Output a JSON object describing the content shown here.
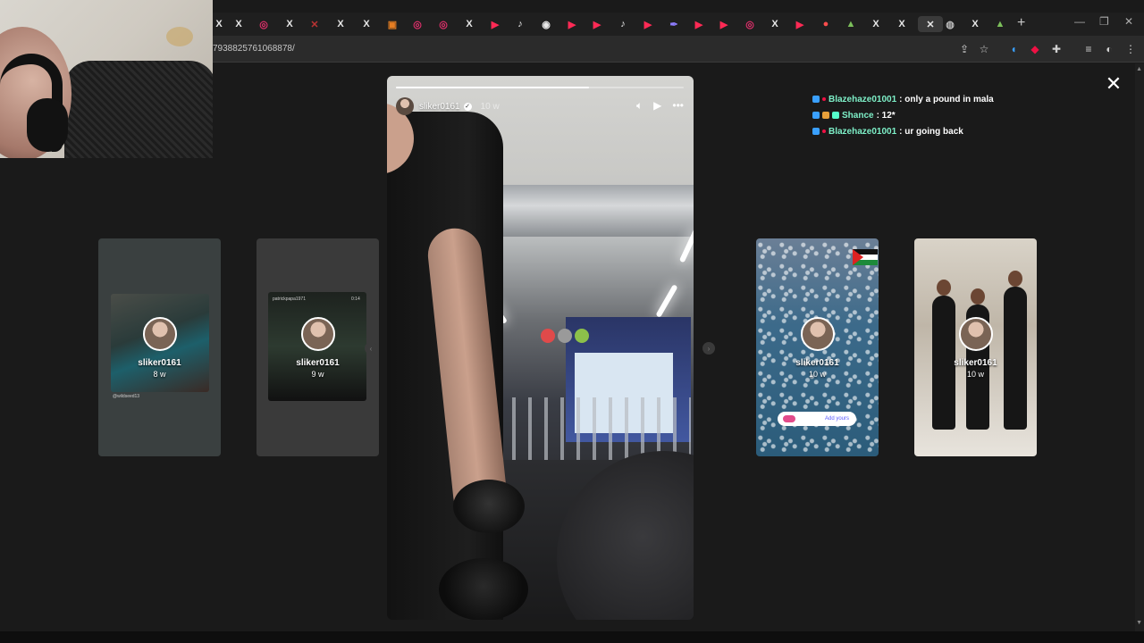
{
  "browser": {
    "tabs": [
      {
        "icon": "x-icon",
        "glyph": "X",
        "color": "#e8e8e8"
      },
      {
        "icon": "x-icon",
        "glyph": "X",
        "color": "#e8e8e8"
      },
      {
        "icon": "instagram-icon",
        "glyph": "◎",
        "color": "#e1306c"
      },
      {
        "icon": "x-icon",
        "glyph": "X",
        "color": "#e8e8e8"
      },
      {
        "icon": "other-icon",
        "glyph": "✕",
        "color": "#b33"
      },
      {
        "icon": "x-icon",
        "glyph": "X",
        "color": "#e8e8e8"
      },
      {
        "icon": "x-icon",
        "glyph": "X",
        "color": "#e8e8e8"
      },
      {
        "icon": "media-icon",
        "glyph": "▣",
        "color": "#e67e22"
      },
      {
        "icon": "instagram-icon",
        "glyph": "◎",
        "color": "#e1306c"
      },
      {
        "icon": "instagram-icon",
        "glyph": "◎",
        "color": "#e1306c"
      },
      {
        "icon": "x-icon",
        "glyph": "X",
        "color": "#e8e8e8"
      },
      {
        "icon": "youtube-icon",
        "glyph": "▶",
        "color": "#ff2a55"
      },
      {
        "icon": "tiktok-icon",
        "glyph": "♪",
        "color": "#e8e8e8"
      },
      {
        "icon": "web-icon",
        "glyph": "◉",
        "color": "#e8e8e8"
      },
      {
        "icon": "youtube-icon",
        "glyph": "▶",
        "color": "#ff2a55"
      },
      {
        "icon": "youtube-icon",
        "glyph": "▶",
        "color": "#ff2a55"
      },
      {
        "icon": "tiktok-icon",
        "glyph": "♪",
        "color": "#e8e8e8"
      },
      {
        "icon": "youtube-icon",
        "glyph": "▶",
        "color": "#ff2a55"
      },
      {
        "icon": "feather-icon",
        "glyph": "✒",
        "color": "#8e7dff"
      },
      {
        "icon": "youtube-icon",
        "glyph": "▶",
        "color": "#ff2a55"
      },
      {
        "icon": "youtube-icon",
        "glyph": "▶",
        "color": "#ff2a55"
      },
      {
        "icon": "instagram-icon",
        "glyph": "◎",
        "color": "#e1306c"
      },
      {
        "icon": "x-icon",
        "glyph": "X",
        "color": "#e8e8e8"
      },
      {
        "icon": "youtube-icon",
        "glyph": "▶",
        "color": "#ff2a55"
      },
      {
        "icon": "apple-icon",
        "glyph": "●",
        "color": "#ff4d4d"
      },
      {
        "icon": "frog-icon",
        "glyph": "▲",
        "color": "#7cbf5b"
      },
      {
        "icon": "x-icon",
        "glyph": "X",
        "color": "#e8e8e8"
      },
      {
        "icon": "x-icon",
        "glyph": "X",
        "color": "#e8e8e8"
      },
      {
        "icon": "close-tab-icon",
        "glyph": "✕",
        "color": "#e8e8e8",
        "active": true
      },
      {
        "icon": "web-icon",
        "glyph": "◍",
        "color": "#bbb"
      },
      {
        "icon": "x-icon",
        "glyph": "X",
        "color": "#e8e8e8"
      },
      {
        "icon": "frog-icon",
        "glyph": "▲",
        "color": "#7cbf5b"
      }
    ],
    "new_tab": "+",
    "url": "7938825761068878/"
  },
  "chat": [
    {
      "user": "Blazehaze01001",
      "message": ": only a pound in mala",
      "badges": [
        "#3aa0ff",
        "#e14"
      ]
    },
    {
      "user": "Shance",
      "message": ": 12*",
      "badges": [
        "#3aa0ff",
        "#e8a03a",
        "#5fc"
      ]
    },
    {
      "user": "Blazehaze01001",
      "message": ": ur going back",
      "badges": [
        "#3aa0ff",
        "#e14"
      ]
    }
  ],
  "story": {
    "username": "sliker0161",
    "time": "10 w",
    "progress": 0.67
  },
  "cards": [
    {
      "username": "sliker0161",
      "age": "8 w",
      "caption": "@wildseed13"
    },
    {
      "username": "sliker0161",
      "age": "9 w",
      "caption": "patrickpapa1971",
      "duration": "0:14"
    },
    {
      "username": "sliker0161",
      "age": "10 w",
      "sticker_label": "Add yours"
    },
    {
      "username": "sliker0161",
      "age": "10 w"
    }
  ]
}
